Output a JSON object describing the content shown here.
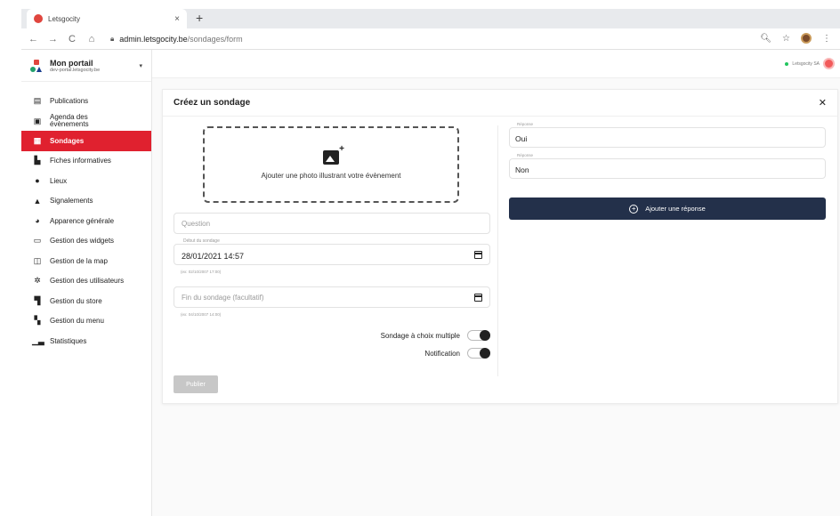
{
  "browser": {
    "tab_title": "Letsgocity",
    "tab_close": "×",
    "new_tab": "+",
    "url_host": "admin.letsgocity.be",
    "url_path": "/sondages/form"
  },
  "sidebar": {
    "portal_name": "Mon portail",
    "portal_sub": "dev-portal.letsgocity.be",
    "items": [
      {
        "label": "Publications",
        "icon": "newspaper-icon"
      },
      {
        "label": "Agenda des évènements",
        "icon": "calendar-icon"
      },
      {
        "label": "Sondages",
        "icon": "poll-icon",
        "active": true
      },
      {
        "label": "Fiches informatives",
        "icon": "document-icon"
      },
      {
        "label": "Lieux",
        "icon": "map-pin-icon"
      },
      {
        "label": "Signalements",
        "icon": "warning-icon"
      },
      {
        "label": "Apparence générale",
        "icon": "palette-icon"
      },
      {
        "label": "Gestion des widgets",
        "icon": "widgets-icon"
      },
      {
        "label": "Gestion de la map",
        "icon": "map-icon"
      },
      {
        "label": "Gestion des utilisateurs",
        "icon": "gear-icon"
      },
      {
        "label": "Gestion du store",
        "icon": "store-icon"
      },
      {
        "label": "Gestion du menu",
        "icon": "grid-icon"
      },
      {
        "label": "Statistiques",
        "icon": "chart-icon"
      }
    ]
  },
  "topbar": {
    "user_label": "Letsgocity SA"
  },
  "form": {
    "title": "Créez un sondage",
    "photo_label": "Ajouter une photo illustrant votre évènement",
    "question_placeholder": "Question",
    "start_label": "Début du sondage",
    "start_value": "28/01/2021 14:57",
    "start_hint": "(ex: 02/10/2007 17:00)",
    "end_placeholder": "Fin du sondage (facultatif)",
    "end_hint": "(ex: 04/10/2007 14:00)",
    "multiple_label": "Sondage à choix multiple",
    "notification_label": "Notification",
    "publish_label": "Publier"
  },
  "responses": {
    "label": "Réponse",
    "items": [
      "Oui",
      "Non"
    ],
    "add_label": "Ajouter une réponse"
  },
  "colors": {
    "active": "#e0212f",
    "primary_button": "#23304a"
  }
}
